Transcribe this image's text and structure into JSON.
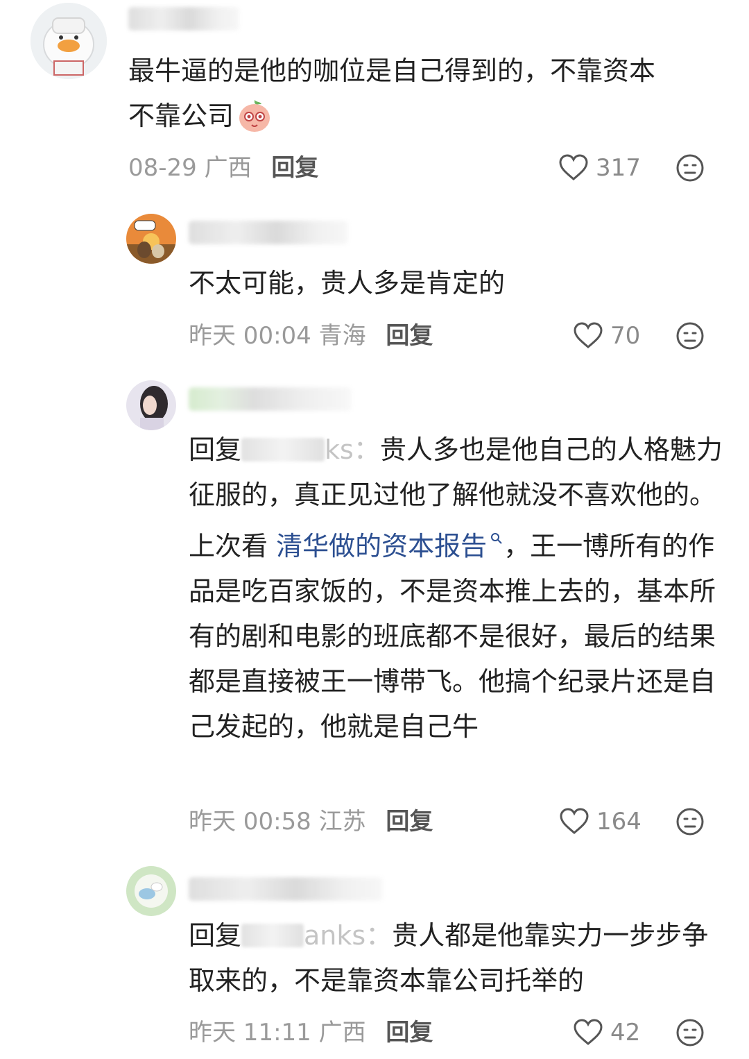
{
  "comments": [
    {
      "text_line1": "最牛逼的是他的咖位是自己得到的，不靠资本",
      "text_line2": "不靠公司",
      "emoji": "shy-face-emoji",
      "date": "08-29",
      "location": "广西",
      "reply_label": "回复",
      "likes": "317"
    },
    {
      "text": "不太可能，贵人多是肯定的",
      "date": "昨天 00:04",
      "location": "青海",
      "reply_label": "回复",
      "likes": "70"
    },
    {
      "reply_prefix": "回复",
      "mention_tail": "ks：",
      "text_a": "贵人多也是他自己的人格魅力征服的，真正见过他了解他就没不喜欢他的。上次看",
      "link_text": "清华做的资本报告",
      "text_b": "，王一博所有的作品是吃百家饭的，不是资本推上去的，基本所有的剧和电影的班底都不是很好，最后的结果都是直接被王一博带飞。他搞个纪录片还是自己发起的，他就是自己牛",
      "date": "昨天 00:58",
      "location": "江苏",
      "reply_label": "回复",
      "likes": "164"
    },
    {
      "reply_prefix": "回复",
      "mention_tail": "anks：",
      "text": "贵人都是他靠实力一步步争取来的，不是靠资本靠公司托举的",
      "date": "昨天 11:11",
      "location": "广西",
      "reply_label": "回复",
      "likes": "42"
    }
  ],
  "colors": {
    "text": "#222222",
    "meta": "#9a9a9a",
    "link": "#2c4f91"
  },
  "icons": [
    "heart-outline-icon",
    "dislike-face-icon",
    "search-link-icon"
  ]
}
